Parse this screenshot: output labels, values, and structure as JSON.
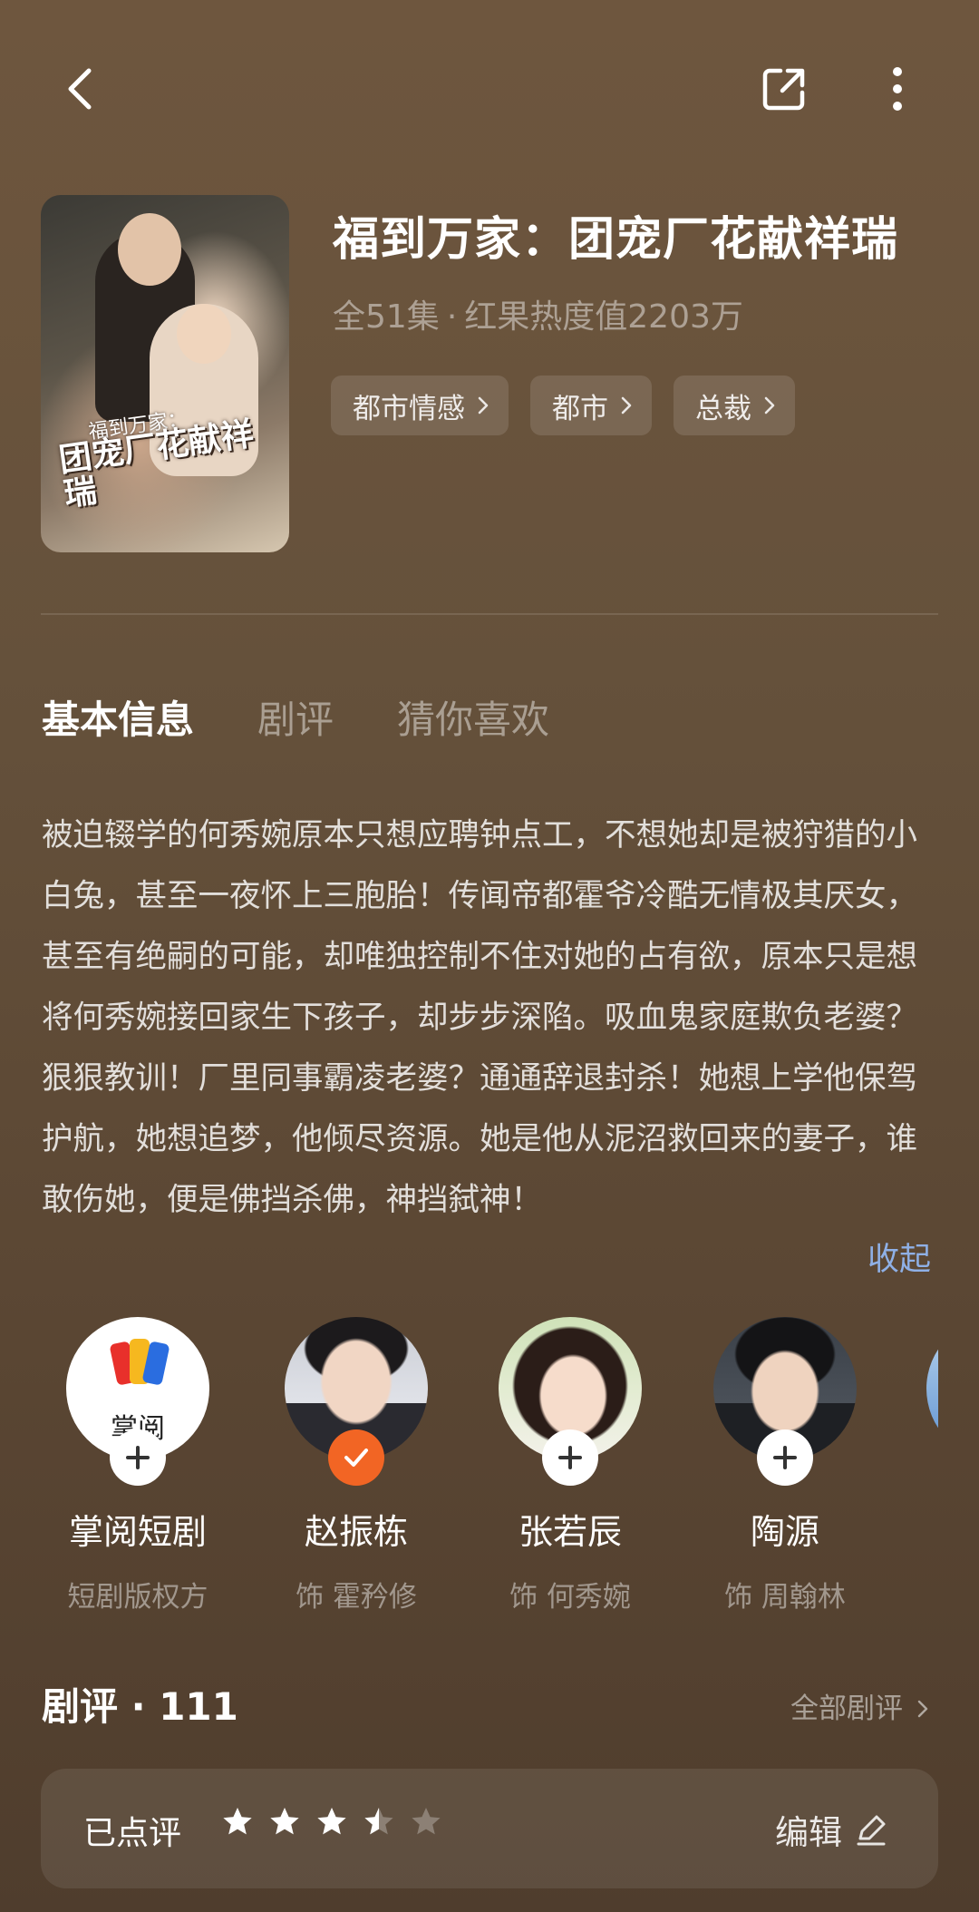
{
  "header": {
    "title": "福到万家：团宠厂花献祥瑞",
    "episodes": "全51集",
    "separator": "·",
    "heat": "红果热度值2203万",
    "tags": [
      "都市情感",
      "都市",
      "总裁"
    ]
  },
  "poster": {
    "text_line1": "福到万家：",
    "text_line2": "团宠厂花献祥瑞"
  },
  "tabs": [
    "基本信息",
    "剧评",
    "猜你喜欢"
  ],
  "synopsis": "被迫辍学的何秀婉原本只想应聘钟点工，不想她却是被狩猎的小白兔，甚至一夜怀上三胞胎！传闻帝都霍爷冷酷无情极其厌女，甚至有绝嗣的可能，却唯独控制不住对她的占有欲，原本只是想将何秀婉接回家生下孩子，却步步深陷。吸血鬼家庭欺负老婆？狠狠教训！厂里同事霸凌老婆？通通辞退封杀！她想上学他保驾护航，她想追梦，他倾尽资源。她是他从泥沼救回来的妻子，谁敢伤她，便是佛挡杀佛，神挡弑神！",
  "collapse_label": "收起",
  "cast": [
    {
      "name": "掌阅短剧",
      "role": "短剧版权方",
      "followed": false,
      "logo_text": "掌阅"
    },
    {
      "name": "赵振栋",
      "role": "饰 霍矜修",
      "followed": true
    },
    {
      "name": "张若辰",
      "role": "饰 何秀婉",
      "followed": false
    },
    {
      "name": "陶源",
      "role": "饰 周翰林",
      "followed": false
    }
  ],
  "reviews": {
    "title": "剧评 · 111",
    "all_label": "全部剧评",
    "rated_label": "已点评",
    "rating": 3.5,
    "max_rating": 5,
    "edit_label": "编辑"
  },
  "colors": {
    "accent_orange": "#f26524",
    "link_blue": "#8fb0e6"
  },
  "icons": {
    "back": "chevron-left-icon",
    "share": "share-icon",
    "more": "more-vertical-icon"
  }
}
